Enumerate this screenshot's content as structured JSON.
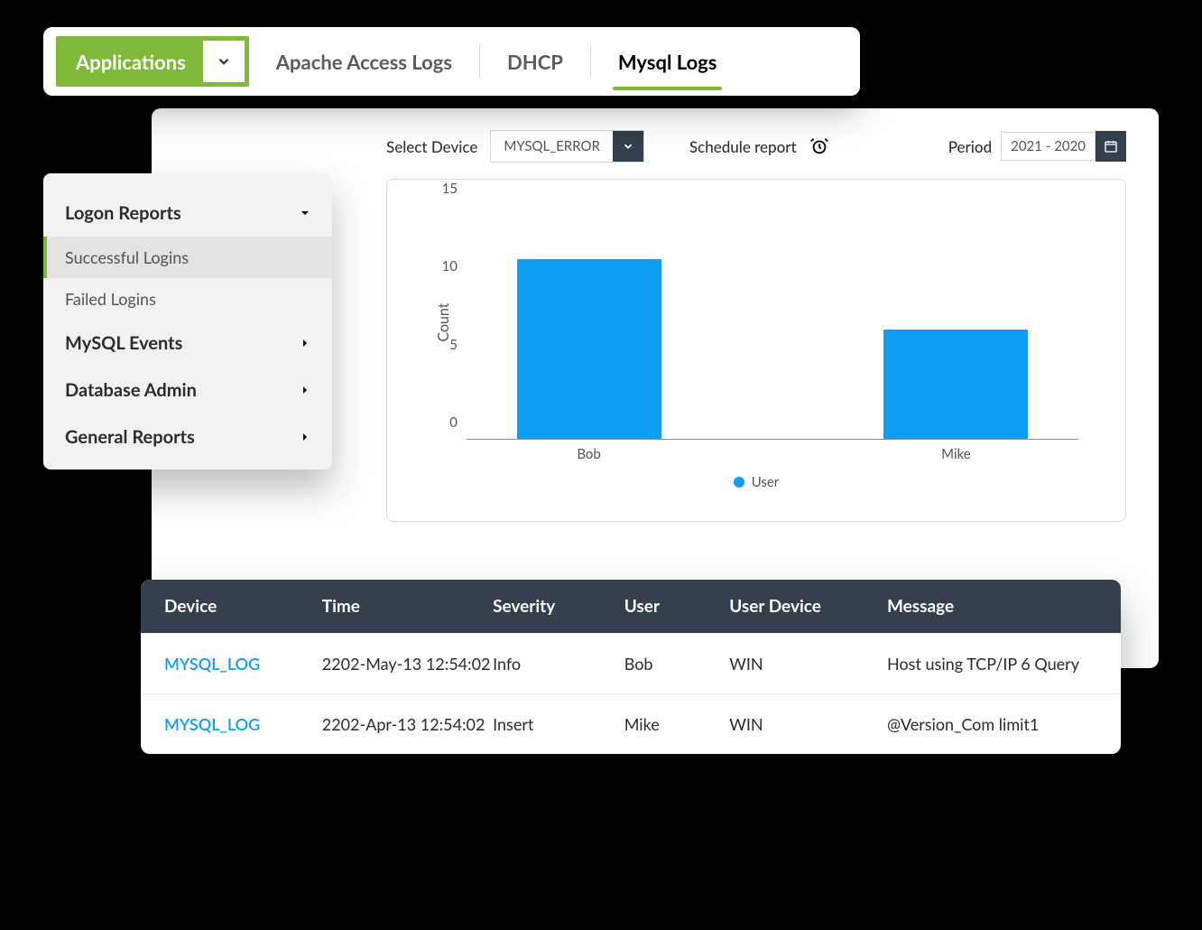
{
  "header": {
    "dropdown_label": "Applications",
    "tabs": [
      "Apache Access Logs",
      "DHCP",
      "Mysql Logs"
    ],
    "active_tab": 2
  },
  "toolbar": {
    "select_device_label": "Select Device",
    "select_device_value": "MYSQL_ERROR",
    "schedule_label": "Schedule report",
    "period_label": "Period",
    "period_value": "2021 - 2020"
  },
  "sidebar": {
    "groups": [
      {
        "label": "Logon Reports",
        "open": true,
        "items": [
          {
            "label": "Successful Logins",
            "active": true
          },
          {
            "label": "Failed Logins",
            "active": false
          }
        ]
      },
      {
        "label": "MySQL Events",
        "open": false
      },
      {
        "label": "Database Admin",
        "open": false
      },
      {
        "label": "General Reports",
        "open": false
      }
    ]
  },
  "chart_data": {
    "type": "bar",
    "title": "",
    "ylabel": "Count",
    "xlabel": "",
    "legend": "User",
    "categories": [
      "Bob",
      "Mike"
    ],
    "values": [
      11.5,
      7
    ],
    "yticks": [
      0,
      5,
      10,
      15
    ],
    "ylim": [
      0,
      15
    ]
  },
  "table": {
    "columns": [
      "Device",
      "Time",
      "Severity",
      "User",
      "User Device",
      "Message"
    ],
    "rows": [
      {
        "device": "MYSQL_LOG",
        "time": "2202-May-13 12:54:02",
        "severity": "Info",
        "user": "Bob",
        "user_device": "WIN",
        "message": "Host using TCP/IP 6 Query"
      },
      {
        "device": "MYSQL_LOG",
        "time": "2202-Apr-13 12:54:02",
        "severity": "Insert",
        "user": "Mike",
        "user_device": "WIN",
        "message": "@Version_Com limit1"
      }
    ]
  }
}
